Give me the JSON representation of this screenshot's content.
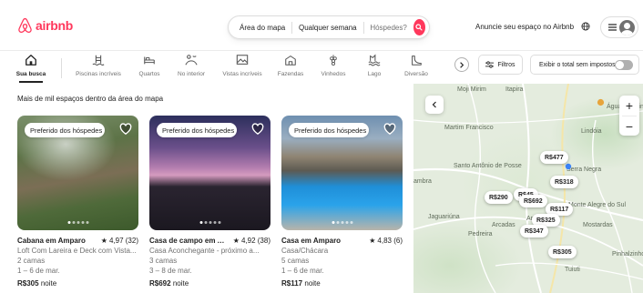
{
  "header": {
    "logo_text": "airbnb",
    "search": {
      "location": "Área do mapa",
      "dates": "Qualquer semana",
      "guests": "Hóspedes?"
    },
    "host_link": "Anuncie seu espaço no Airbnb"
  },
  "categories": [
    {
      "label": "Sua busca",
      "icon": "home-icon",
      "active": true
    },
    {
      "label": "Piscinas incríveis",
      "icon": "pool-icon",
      "active": false
    },
    {
      "label": "Quartos",
      "icon": "bed-icon",
      "active": false
    },
    {
      "label": "No interior",
      "icon": "countryside-icon",
      "active": false
    },
    {
      "label": "Vistas incríveis",
      "icon": "view-icon",
      "active": false
    },
    {
      "label": "Fazendas",
      "icon": "farm-icon",
      "active": false
    },
    {
      "label": "Vinhedos",
      "icon": "grapes-icon",
      "active": false
    },
    {
      "label": "Lago",
      "icon": "lake-icon",
      "active": false
    },
    {
      "label": "Diversão",
      "icon": "slide-icon",
      "active": false
    }
  ],
  "filters_label": "Filtros",
  "total_toggle": {
    "label": "Exibir o total sem impostos",
    "on": false
  },
  "results_title": "Mais de mil espaços dentro da área do mapa",
  "listings": [
    {
      "badge": "Preferido dos hóspedes",
      "title": "Cabana em Amparo",
      "rating": "4,97 (32)",
      "description": "Loft Com Lareira e Deck com Vista...",
      "beds": "2 camas",
      "dates": "1 – 6 de mar.",
      "price": "R$305",
      "price_suffix": "noite"
    },
    {
      "badge": "Preferido dos hóspedes",
      "title": "Casa de campo em Amparo",
      "rating": "4,92 (38)",
      "description": "Casa Aconchegante - próximo a...",
      "beds": "3 camas",
      "dates": "3 – 8 de mar.",
      "price": "R$692",
      "price_suffix": "noite"
    },
    {
      "badge": "Preferido dos hóspedes",
      "title": "Casa em Amparo",
      "rating": "4,83 (6)",
      "description": "Casa/Chácara",
      "beds": "5 camas",
      "dates": "1 – 6 de mar.",
      "price": "R$117",
      "price_suffix": "noite"
    }
  ],
  "map": {
    "towns": [
      "Moji Mirim",
      "Itapira",
      "Águas de Lindóia",
      "Lindóia",
      "Martim Francisco",
      "Santo Antônio de Posse",
      "Serra Negra",
      "Monte Alegre do Sul",
      "Jaguariúna",
      "Pedreira",
      "Arcadas",
      "Amparo",
      "Mostardas",
      "Pinhalzinho",
      "Tuiuti",
      "ambra"
    ],
    "price_pins": [
      "R$477",
      "R$318",
      "R$290",
      "R$692",
      "R$117",
      "R$325",
      "R$347",
      "R$305",
      "R$45"
    ]
  }
}
